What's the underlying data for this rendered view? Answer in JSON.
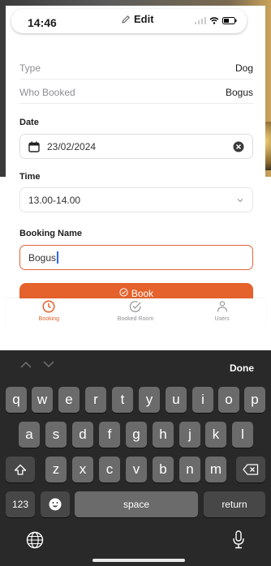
{
  "status_bar": {
    "time": "14:46",
    "title": "Edit"
  },
  "details": [
    {
      "key": "Type",
      "value": "Dog"
    },
    {
      "key": "Who Booked",
      "value": "Bogus"
    }
  ],
  "date": {
    "label": "Date",
    "value": "23/02/2024"
  },
  "time_field": {
    "label": "Time",
    "value": "13.00-14.00"
  },
  "booking_name": {
    "label": "Booking Name",
    "value": "Bogus"
  },
  "book_button": {
    "label": "Book"
  },
  "tabs": [
    {
      "label": "Booking",
      "icon": "clock-icon",
      "active": true
    },
    {
      "label": "Booked Room",
      "icon": "check-circle-icon",
      "active": false
    },
    {
      "label": "Users",
      "icon": "user-icon",
      "active": false
    }
  ],
  "keyboard": {
    "done_label": "Done",
    "row1": [
      "q",
      "w",
      "e",
      "r",
      "t",
      "y",
      "u",
      "i",
      "o",
      "p"
    ],
    "row2": [
      "a",
      "s",
      "d",
      "f",
      "g",
      "h",
      "j",
      "k",
      "l"
    ],
    "row3": [
      "z",
      "x",
      "c",
      "v",
      "b",
      "n",
      "m"
    ],
    "numbers_label": "123",
    "space_label": "space",
    "return_label": "return"
  },
  "colors": {
    "accent": "#e5622c",
    "keyboard_bg": "#292929",
    "key": "#6b6b6b"
  }
}
